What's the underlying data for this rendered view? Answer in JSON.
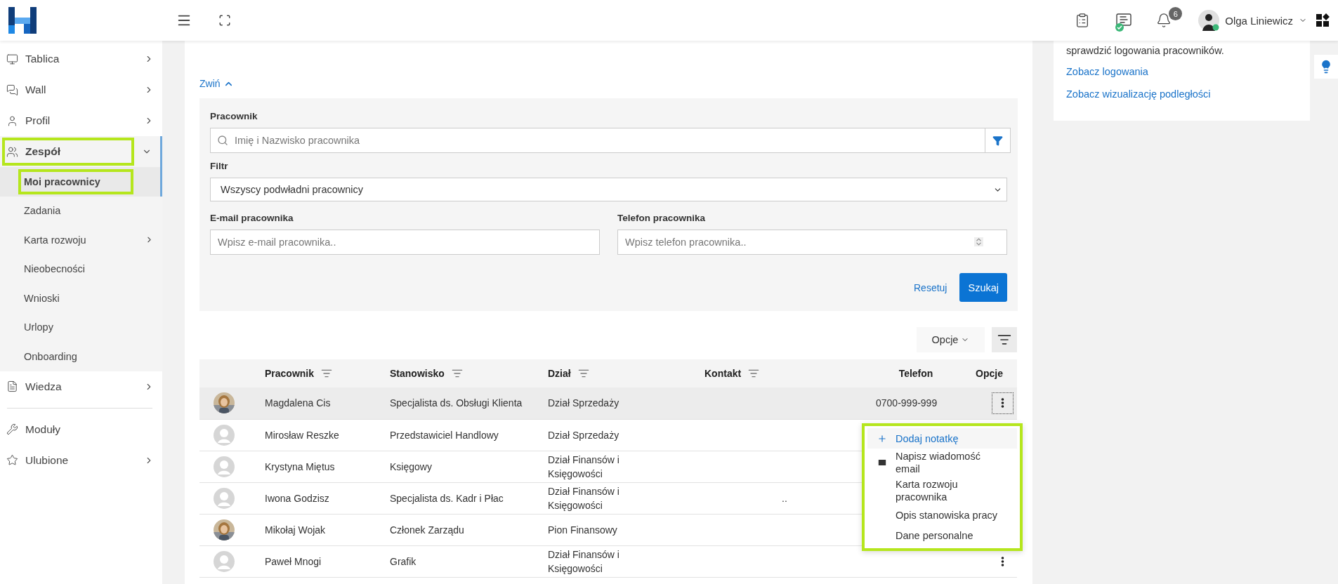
{
  "header": {
    "user_name": "Olga Liniewicz",
    "notifications_count": "6"
  },
  "sidebar": {
    "items": [
      {
        "label": "Tablica",
        "has_submenu": true,
        "expanded": false,
        "highlighted": false
      },
      {
        "label": "Wall",
        "has_submenu": true,
        "expanded": false,
        "highlighted": false
      },
      {
        "label": "Profil",
        "has_submenu": true,
        "expanded": false,
        "highlighted": false
      },
      {
        "label": "Zespół",
        "has_submenu": true,
        "expanded": true,
        "highlighted": true,
        "children": [
          {
            "label": "Moi pracownicy",
            "selected": true,
            "highlighted": true,
            "has_submenu": false
          },
          {
            "label": "Zadania",
            "selected": false,
            "highlighted": false,
            "has_submenu": false
          },
          {
            "label": "Karta rozwoju",
            "selected": false,
            "highlighted": false,
            "has_submenu": true
          },
          {
            "label": "Nieobecności",
            "selected": false,
            "highlighted": false,
            "has_submenu": false
          },
          {
            "label": "Wnioski",
            "selected": false,
            "highlighted": false,
            "has_submenu": false
          },
          {
            "label": "Urlopy",
            "selected": false,
            "highlighted": false,
            "has_submenu": false
          },
          {
            "label": "Onboarding",
            "selected": false,
            "highlighted": false,
            "has_submenu": false
          }
        ]
      },
      {
        "label": "Wiedza",
        "has_submenu": true,
        "expanded": false,
        "highlighted": false,
        "divider_after": true
      },
      {
        "label": "Moduły",
        "has_submenu": false,
        "expanded": false,
        "highlighted": false
      },
      {
        "label": "Ulubione",
        "has_submenu": true,
        "expanded": false,
        "highlighted": false
      }
    ]
  },
  "main": {
    "collapse_link": "Zwiń",
    "filters": {
      "employee_label": "Pracownik",
      "employee_placeholder": "Imię i Nazwisko pracownika",
      "filter_label": "Filtr",
      "filter_value": "Wszyscy podwładni pracownicy",
      "email_label": "E-mail pracownika",
      "email_placeholder": "Wpisz e-mail pracownika..",
      "phone_label": "Telefon pracownika",
      "phone_placeholder": "Wpisz telefon pracownika..",
      "reset": "Resetuj",
      "search": "Szukaj"
    },
    "toolbar": {
      "options": "Opcje"
    },
    "table": {
      "columns": [
        {
          "label": "Pracownik",
          "sortable": true
        },
        {
          "label": "Stanowisko",
          "sortable": true
        },
        {
          "label": "Dział",
          "sortable": true
        },
        {
          "label": "Kontakt",
          "sortable": true
        },
        {
          "label": "Telefon",
          "sortable": false
        },
        {
          "label": "Opcje",
          "sortable": false
        }
      ],
      "rows": [
        {
          "name": "Magdalena Cis",
          "position": "Specjalista ds. Obsługi Klienta",
          "department": "Dział Sprzedaży",
          "phone": "0700-999-999",
          "selected": true,
          "menu_button": true
        },
        {
          "kind": "placeholder",
          "name": "Mirosław Reszke",
          "position": "Przedstawiciel Handlowy",
          "department": "Dział Sprzedaży",
          "selected": false,
          "menu_button": false
        },
        {
          "kind": "placeholder",
          "name": "Krystyna Miętus",
          "position": "Księgowy",
          "department": "Dział Finansów i Księgowości",
          "selected": false,
          "menu_button": false
        },
        {
          "kind": "placeholder",
          "name": "Iwona Godzisz",
          "position": "Specjalista ds. Kadr i Płac",
          "department": "Dział Finansów i Księgowości",
          "contact": "..",
          "selected": false,
          "menu_button": false
        },
        {
          "name": "Mikołaj Wojak",
          "position": "Członek Zarządu",
          "department": "Pion Finansowy",
          "selected": false,
          "menu_button": false
        },
        {
          "kind": "placeholder",
          "name": "Paweł Mnogi",
          "position": "Grafik",
          "department": "Dział Finansów i Księgowości",
          "selected": false,
          "menu_button": true
        }
      ]
    },
    "context_menu": {
      "highlighted": true,
      "items": [
        {
          "label": "Dodaj notatkę",
          "active": true
        },
        {
          "label": "Napisz wiadomość email",
          "active": false
        },
        {
          "label": "Karta rozwoju pracownika",
          "active": false
        },
        {
          "label": "Opis stanowiska pracy",
          "active": false
        },
        {
          "label": "Dane personalne",
          "active": false
        }
      ]
    }
  },
  "right_panel": {
    "text": "sprawdzić logowania pracowników.",
    "links": [
      "Zobacz logowania",
      "Zobacz wizualizację podległości"
    ]
  }
}
